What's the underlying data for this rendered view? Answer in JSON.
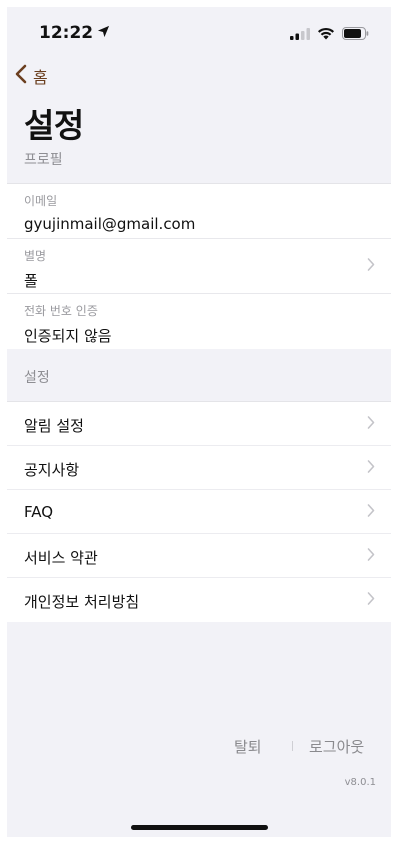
{
  "status_bar": {
    "time": "12:22",
    "location_icon": "location-arrow-icon",
    "signal_icon": "cellular-signal-icon",
    "wifi_icon": "wifi-icon",
    "battery_icon": "battery-icon"
  },
  "nav": {
    "back_label": "홈",
    "back_icon": "chevron-left-icon"
  },
  "title": "설정",
  "profile": {
    "section_label": "프로필",
    "fields": [
      {
        "label": "이메일",
        "value": "gyujinmail@gmail.com",
        "has_chevron": false
      },
      {
        "label": "별명",
        "value": "폴",
        "has_chevron": true
      },
      {
        "label": "전화 번호 인증",
        "value": "인증되지 않음",
        "has_chevron": false
      }
    ]
  },
  "settings": {
    "section_label": "설정",
    "items": [
      {
        "label": "알림 설정"
      },
      {
        "label": "공지사항"
      },
      {
        "label": "FAQ"
      },
      {
        "label": "서비스 약관"
      },
      {
        "label": "개인정보 처리방침"
      }
    ]
  },
  "footer": {
    "withdraw_label": "탈퇴",
    "logout_label": "로그아웃",
    "version": "v8.0.1"
  },
  "colors": {
    "accent": "#6b3f1f",
    "background": "#f2f2f7",
    "secondary_text": "#8e8e93"
  }
}
